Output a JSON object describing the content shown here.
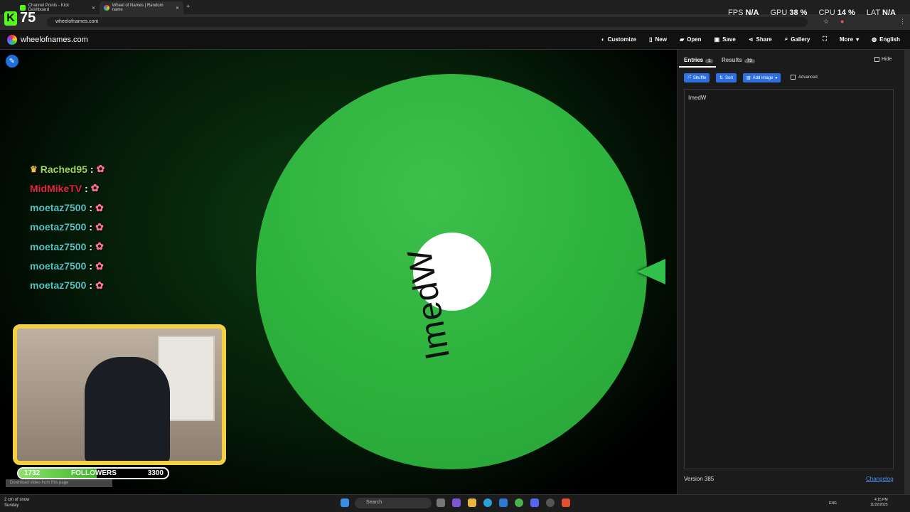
{
  "browser": {
    "tabs": [
      {
        "label": "Channel Points - Kick Dashboard"
      },
      {
        "label": "Wheel of Names | Random name"
      }
    ],
    "url": "wheelofnames.com"
  },
  "overlay": {
    "kick_count": "75",
    "stats": [
      {
        "label": "FPS",
        "value": "N/A"
      },
      {
        "label": "GPU",
        "value": "38 %"
      },
      {
        "label": "CPU",
        "value": "14 %"
      },
      {
        "label": "LAT",
        "value": "N/A"
      }
    ]
  },
  "site": {
    "logo_text": "wheelofnames.com",
    "menu": [
      "Customize",
      "New",
      "Open",
      "Save",
      "Share",
      "Gallery",
      "More",
      "English"
    ]
  },
  "wheel": {
    "label": "ImedW",
    "color": "#2eb33e"
  },
  "chat": [
    {
      "user": "Rached95",
      "color": "#9fd85b",
      "crown": true
    },
    {
      "user": "MidMikeTV",
      "color": "#e0283a",
      "crown": false
    },
    {
      "user": "moetaz7500",
      "color": "#4ec6c2",
      "crown": false
    },
    {
      "user": "moetaz7500",
      "color": "#4ec6c2",
      "crown": false
    },
    {
      "user": "moetaz7500",
      "color": "#4ec6c2",
      "crown": false
    },
    {
      "user": "moetaz7500",
      "color": "#4ec6c2",
      "crown": false
    },
    {
      "user": "moetaz7500",
      "color": "#4ec6c2",
      "crown": false
    }
  ],
  "followers": {
    "current": "1732",
    "label": "FOLLOWERS",
    "goal": "3300",
    "fraction": 0.525
  },
  "download_bar": "Download video from this page",
  "panel": {
    "tab_entries": "Entries",
    "entries_count": "1",
    "tab_results": "Results",
    "results_count": "73",
    "hide_label": "Hide",
    "shuffle": "Shuffle",
    "sort": "Sort",
    "add_image": "Add image",
    "advanced": "Advanced",
    "entries_text": "ImedW",
    "version": "Version 385",
    "changelog": "Changelog"
  },
  "taskbar": {
    "weather_line1": "2 cm of snow",
    "weather_line2": "Sunday",
    "search_placeholder": "Search",
    "lang": "ENG",
    "time": "4:15 PM",
    "date": "11/22/2025"
  }
}
